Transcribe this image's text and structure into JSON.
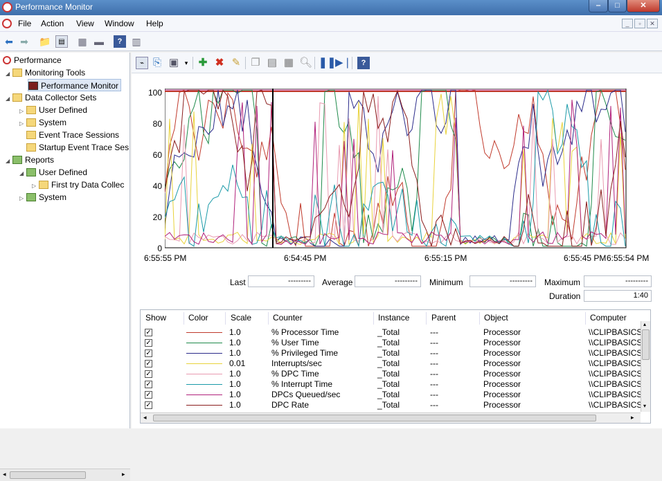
{
  "window": {
    "title": "Performance Monitor",
    "min": "‒",
    "max": "□",
    "close": "✕"
  },
  "menu": [
    "File",
    "Action",
    "View",
    "Window",
    "Help"
  ],
  "tree": {
    "root": "Performance",
    "monitoring_tools": "Monitoring Tools",
    "performance_monitor": "Performance Monitor",
    "data_collector_sets": "Data Collector Sets",
    "dcs_user_defined": "User Defined",
    "dcs_system": "System",
    "event_trace": "Event Trace Sessions",
    "startup_trace": "Startup Event Trace Ses",
    "reports": "Reports",
    "rep_user_defined": "User Defined",
    "first_try": "First try  Data Collec",
    "rep_system": "System"
  },
  "graph": {
    "y_ticks": [
      "100",
      "80",
      "60",
      "40",
      "20",
      "0"
    ],
    "x_ticks": [
      "6:55:55 PM",
      "6:54:45 PM",
      "6:55:15 PM",
      "6:55:45 PM",
      "6:55:54 PM"
    ]
  },
  "stats": {
    "last_label": "Last",
    "last_value": "---------",
    "average_label": "Average",
    "average_value": "---------",
    "minimum_label": "Minimum",
    "minimum_value": "---------",
    "maximum_label": "Maximum",
    "maximum_value": "---------",
    "duration_label": "Duration",
    "duration_value": "1:40"
  },
  "legend": {
    "columns": [
      "Show",
      "Color",
      "Scale",
      "Counter",
      "Instance",
      "Parent",
      "Object",
      "Computer"
    ],
    "rows": [
      {
        "color": "#c0392b",
        "scale": "1.0",
        "counter": "% Processor Time",
        "instance": "_Total",
        "parent": "---",
        "object": "Processor",
        "computer": "\\\\CLIPBASICS"
      },
      {
        "color": "#1e8a4a",
        "scale": "1.0",
        "counter": "% User Time",
        "instance": "_Total",
        "parent": "---",
        "object": "Processor",
        "computer": "\\\\CLIPBASICS"
      },
      {
        "color": "#2a2a8a",
        "scale": "1.0",
        "counter": "% Privileged Time",
        "instance": "_Total",
        "parent": "---",
        "object": "Processor",
        "computer": "\\\\CLIPBASICS"
      },
      {
        "color": "#e8d23a",
        "scale": "0.01",
        "counter": "Interrupts/sec",
        "instance": "_Total",
        "parent": "---",
        "object": "Processor",
        "computer": "\\\\CLIPBASICS"
      },
      {
        "color": "#e89ab0",
        "scale": "1.0",
        "counter": "% DPC Time",
        "instance": "_Total",
        "parent": "---",
        "object": "Processor",
        "computer": "\\\\CLIPBASICS"
      },
      {
        "color": "#1a9aa8",
        "scale": "1.0",
        "counter": "% Interrupt Time",
        "instance": "_Total",
        "parent": "---",
        "object": "Processor",
        "computer": "\\\\CLIPBASICS"
      },
      {
        "color": "#b0207a",
        "scale": "1.0",
        "counter": "DPCs Queued/sec",
        "instance": "_Total",
        "parent": "---",
        "object": "Processor",
        "computer": "\\\\CLIPBASICS"
      },
      {
        "color": "#8a1c1c",
        "scale": "1.0",
        "counter": "DPC Rate",
        "instance": "_Total",
        "parent": "---",
        "object": "Processor",
        "computer": "\\\\CLIPBASICS"
      }
    ]
  }
}
